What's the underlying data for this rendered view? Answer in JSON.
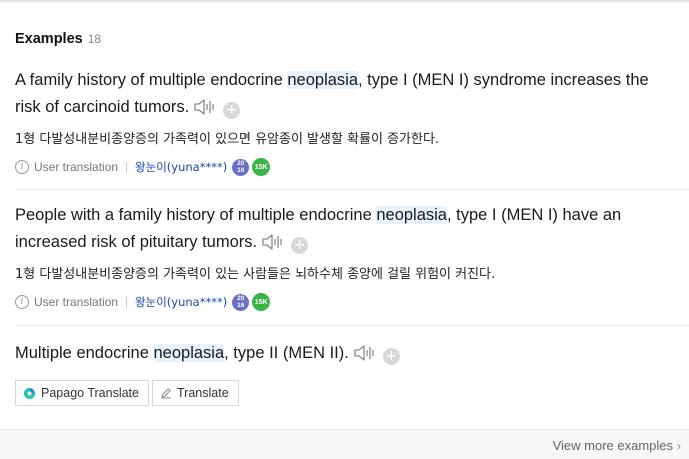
{
  "header": {
    "title": "Examples",
    "count": "18"
  },
  "examples": [
    {
      "pre": "A family history of multiple endocrine ",
      "highlight": "neoplasia",
      "post": ", type I (MEN I) syndrome increases the risk of carcinoid tumors.",
      "translation": "1형 다발성내분비종양증의 가족력이 있으면 유암종이 발생할 확률이 증가한다.",
      "source": "User translation",
      "user": "왕눈이(yuna****)",
      "badge_year_top": "20",
      "badge_year_bottom": "16",
      "badge_level": "15K"
    },
    {
      "pre": "People with a family history of multiple endocrine ",
      "highlight": "neoplasia",
      "post": ", type I (MEN I) have an increased risk of pituitary tumors.",
      "translation": "1형 다발성내분비종양증의 가족력이 있는 사람들은 뇌하수체 종양에 걸릴 위험이 커진다.",
      "source": "User translation",
      "user": "왕눈이(yuna****)",
      "badge_year_top": "20",
      "badge_year_bottom": "16",
      "badge_level": "15K"
    },
    {
      "pre": "Multiple endocrine ",
      "highlight": "neoplasia",
      "post": ", type II (MEN II).",
      "buttons": {
        "papago": "Papago Translate",
        "translate": "Translate"
      }
    }
  ],
  "add_symbol": "+",
  "info_symbol": "i",
  "footer": {
    "more": "View more examples",
    "chevron": "›"
  },
  "colors": {
    "highlight": "#e8f2fc",
    "link": "#1b47a6",
    "badge_year": "#6c6fc9",
    "badge_level": "#3bb54a"
  },
  "icons": [
    "speaker-icon",
    "add-icon",
    "info-icon",
    "papago-icon",
    "pencil-icon",
    "chevron-right-icon"
  ]
}
